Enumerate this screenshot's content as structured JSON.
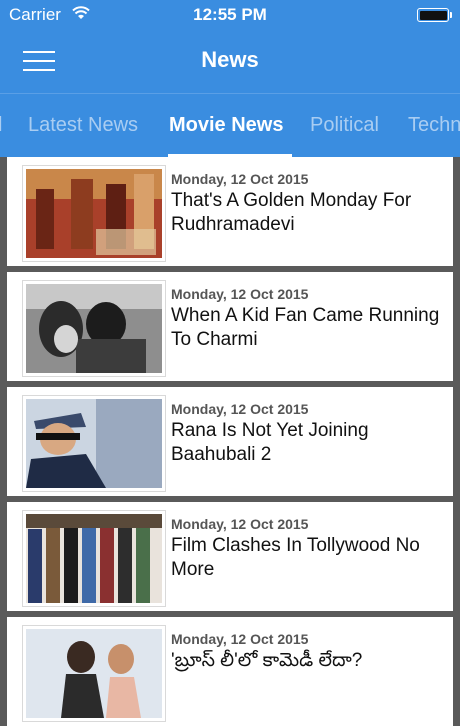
{
  "status_bar": {
    "carrier": "Carrier",
    "time": "12:55 PM"
  },
  "header": {
    "title": "News"
  },
  "tabs": [
    {
      "label": "l"
    },
    {
      "label": "Latest News"
    },
    {
      "label": "Movie News",
      "active": true
    },
    {
      "label": "Political"
    },
    {
      "label": "Techn"
    }
  ],
  "articles": [
    {
      "date": "Monday, 12 Oct 2015",
      "title": "That's A Golden Monday For Rudhramadevi"
    },
    {
      "date": "Monday, 12 Oct 2015",
      "title": "When A Kid Fan Came Running To Charmi"
    },
    {
      "date": "Monday, 12 Oct 2015",
      "title": "Rana Is Not Yet Joining Baahubali 2"
    },
    {
      "date": "Monday, 12 Oct 2015",
      "title": "Film Clashes In Tollywood No More"
    },
    {
      "date": "Monday, 12 Oct 2015",
      "title": "'బ్రూస్ లీ'లో కామెడీ లేదా?"
    }
  ],
  "colors": {
    "header": "#3a8de0",
    "tab_inactive": "#a9cdf2",
    "separator": "#5a5a5a"
  }
}
